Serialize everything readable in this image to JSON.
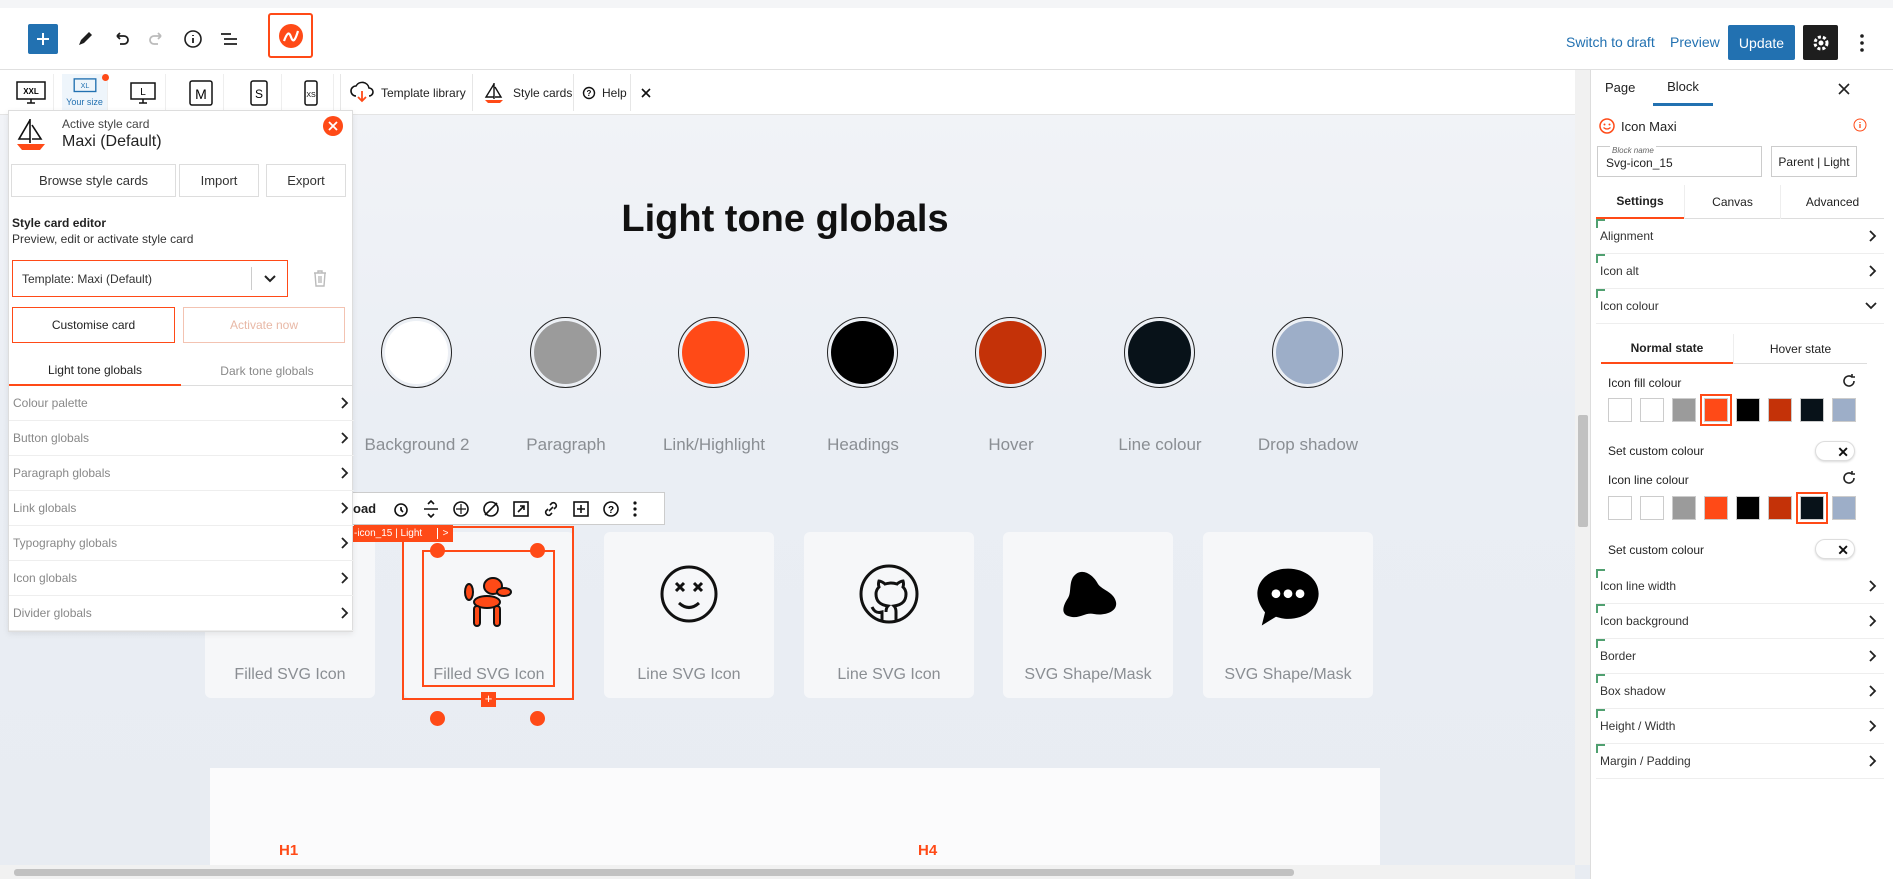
{
  "topbar": {
    "switch_to_draft": "Switch to draft",
    "preview": "Preview",
    "update": "Update"
  },
  "responsive": {
    "breakpoints": [
      "XXL",
      "XL",
      "L",
      "M",
      "S",
      "XS"
    ],
    "your_size": "Your size",
    "template_library": "Template library",
    "style_cards": "Style cards",
    "help": "Help"
  },
  "style_card_panel": {
    "active_label": "Active style card",
    "active_name": "Maxi (Default)",
    "browse": "Browse style cards",
    "import": "Import",
    "export": "Export",
    "editor_title": "Style card editor",
    "editor_desc": "Preview, edit or activate style card",
    "template_select": "Template: Maxi (Default)",
    "customise": "Customise card",
    "activate": "Activate now",
    "tabs": [
      "Light tone globals",
      "Dark tone globals"
    ],
    "sections": [
      "Colour palette",
      "Button globals",
      "Paragraph globals",
      "Link globals",
      "Typography globals",
      "Icon globals",
      "Divider globals"
    ]
  },
  "canvas": {
    "title": "Light tone globals",
    "swatches": [
      {
        "label": "Background 2",
        "color": "#ffffff"
      },
      {
        "label": "Paragraph",
        "color": "#9b9b9b"
      },
      {
        "label": "Link/Highlight",
        "color": "#ff4a17"
      },
      {
        "label": "Headings",
        "color": "#000000"
      },
      {
        "label": "Hover",
        "color": "#c43208"
      },
      {
        "label": "Line colour",
        "color": "#081219"
      },
      {
        "label": "Drop shadow",
        "color": "#9daec8"
      }
    ],
    "cards": [
      "Filled SVG Icon",
      "Filled SVG Icon",
      "Line SVG Icon",
      "Line SVG Icon",
      "SVG Shape/Mask",
      "SVG Shape/Mask"
    ],
    "toolbar_label": "oad",
    "selection_tag": "-icon_15 | Light",
    "selection_tag_arrow": ">",
    "h1": "H1",
    "h4": "H4"
  },
  "right_panel": {
    "tabs": [
      "Page",
      "Block"
    ],
    "block_title": "Icon Maxi",
    "block_name_label": "Block name",
    "block_name": "Svg-icon_15",
    "parent_btn": "Parent | Light",
    "sub_tabs": [
      "Settings",
      "Canvas",
      "Advanced"
    ],
    "rows_top": [
      "Alignment",
      "Icon alt",
      "Icon colour"
    ],
    "state_tabs": [
      "Normal state",
      "Hover state"
    ],
    "fill_label": "Icon fill colour",
    "custom_label": "Set custom colour",
    "line_label": "Icon line colour",
    "palette": [
      "#ffffff",
      "#ffffff",
      "#9b9b9b",
      "#ff4a17",
      "#000000",
      "#c43208",
      "#081219",
      "#9daec8"
    ],
    "rows_bottom": [
      "Icon line width",
      "Icon background",
      "Border",
      "Box shadow",
      "Height / Width",
      "Margin / Padding"
    ]
  }
}
